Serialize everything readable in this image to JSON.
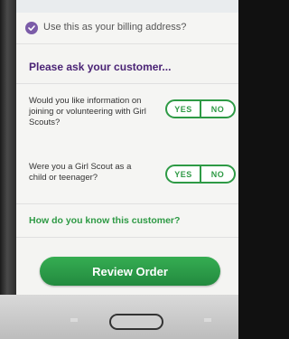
{
  "billing": {
    "label": "Use this as your billing address?",
    "checked": true
  },
  "section": {
    "title": "Please ask your customer..."
  },
  "questions": [
    {
      "text": "Would you like information on joining or volunteering with Girl Scouts?",
      "yes_label": "YES",
      "no_label": "NO"
    },
    {
      "text": "Were you a Girl Scout as a child or teenager?",
      "yes_label": "YES",
      "no_label": "NO"
    }
  ],
  "how_known": {
    "label": "How do you know this customer?"
  },
  "review_button": {
    "label": "Review Order"
  },
  "colors": {
    "purple": "#4a2375",
    "green": "#2e9a45",
    "button_green": "#2a9446"
  },
  "icons": {
    "billing_check": "checkmark-icon"
  }
}
